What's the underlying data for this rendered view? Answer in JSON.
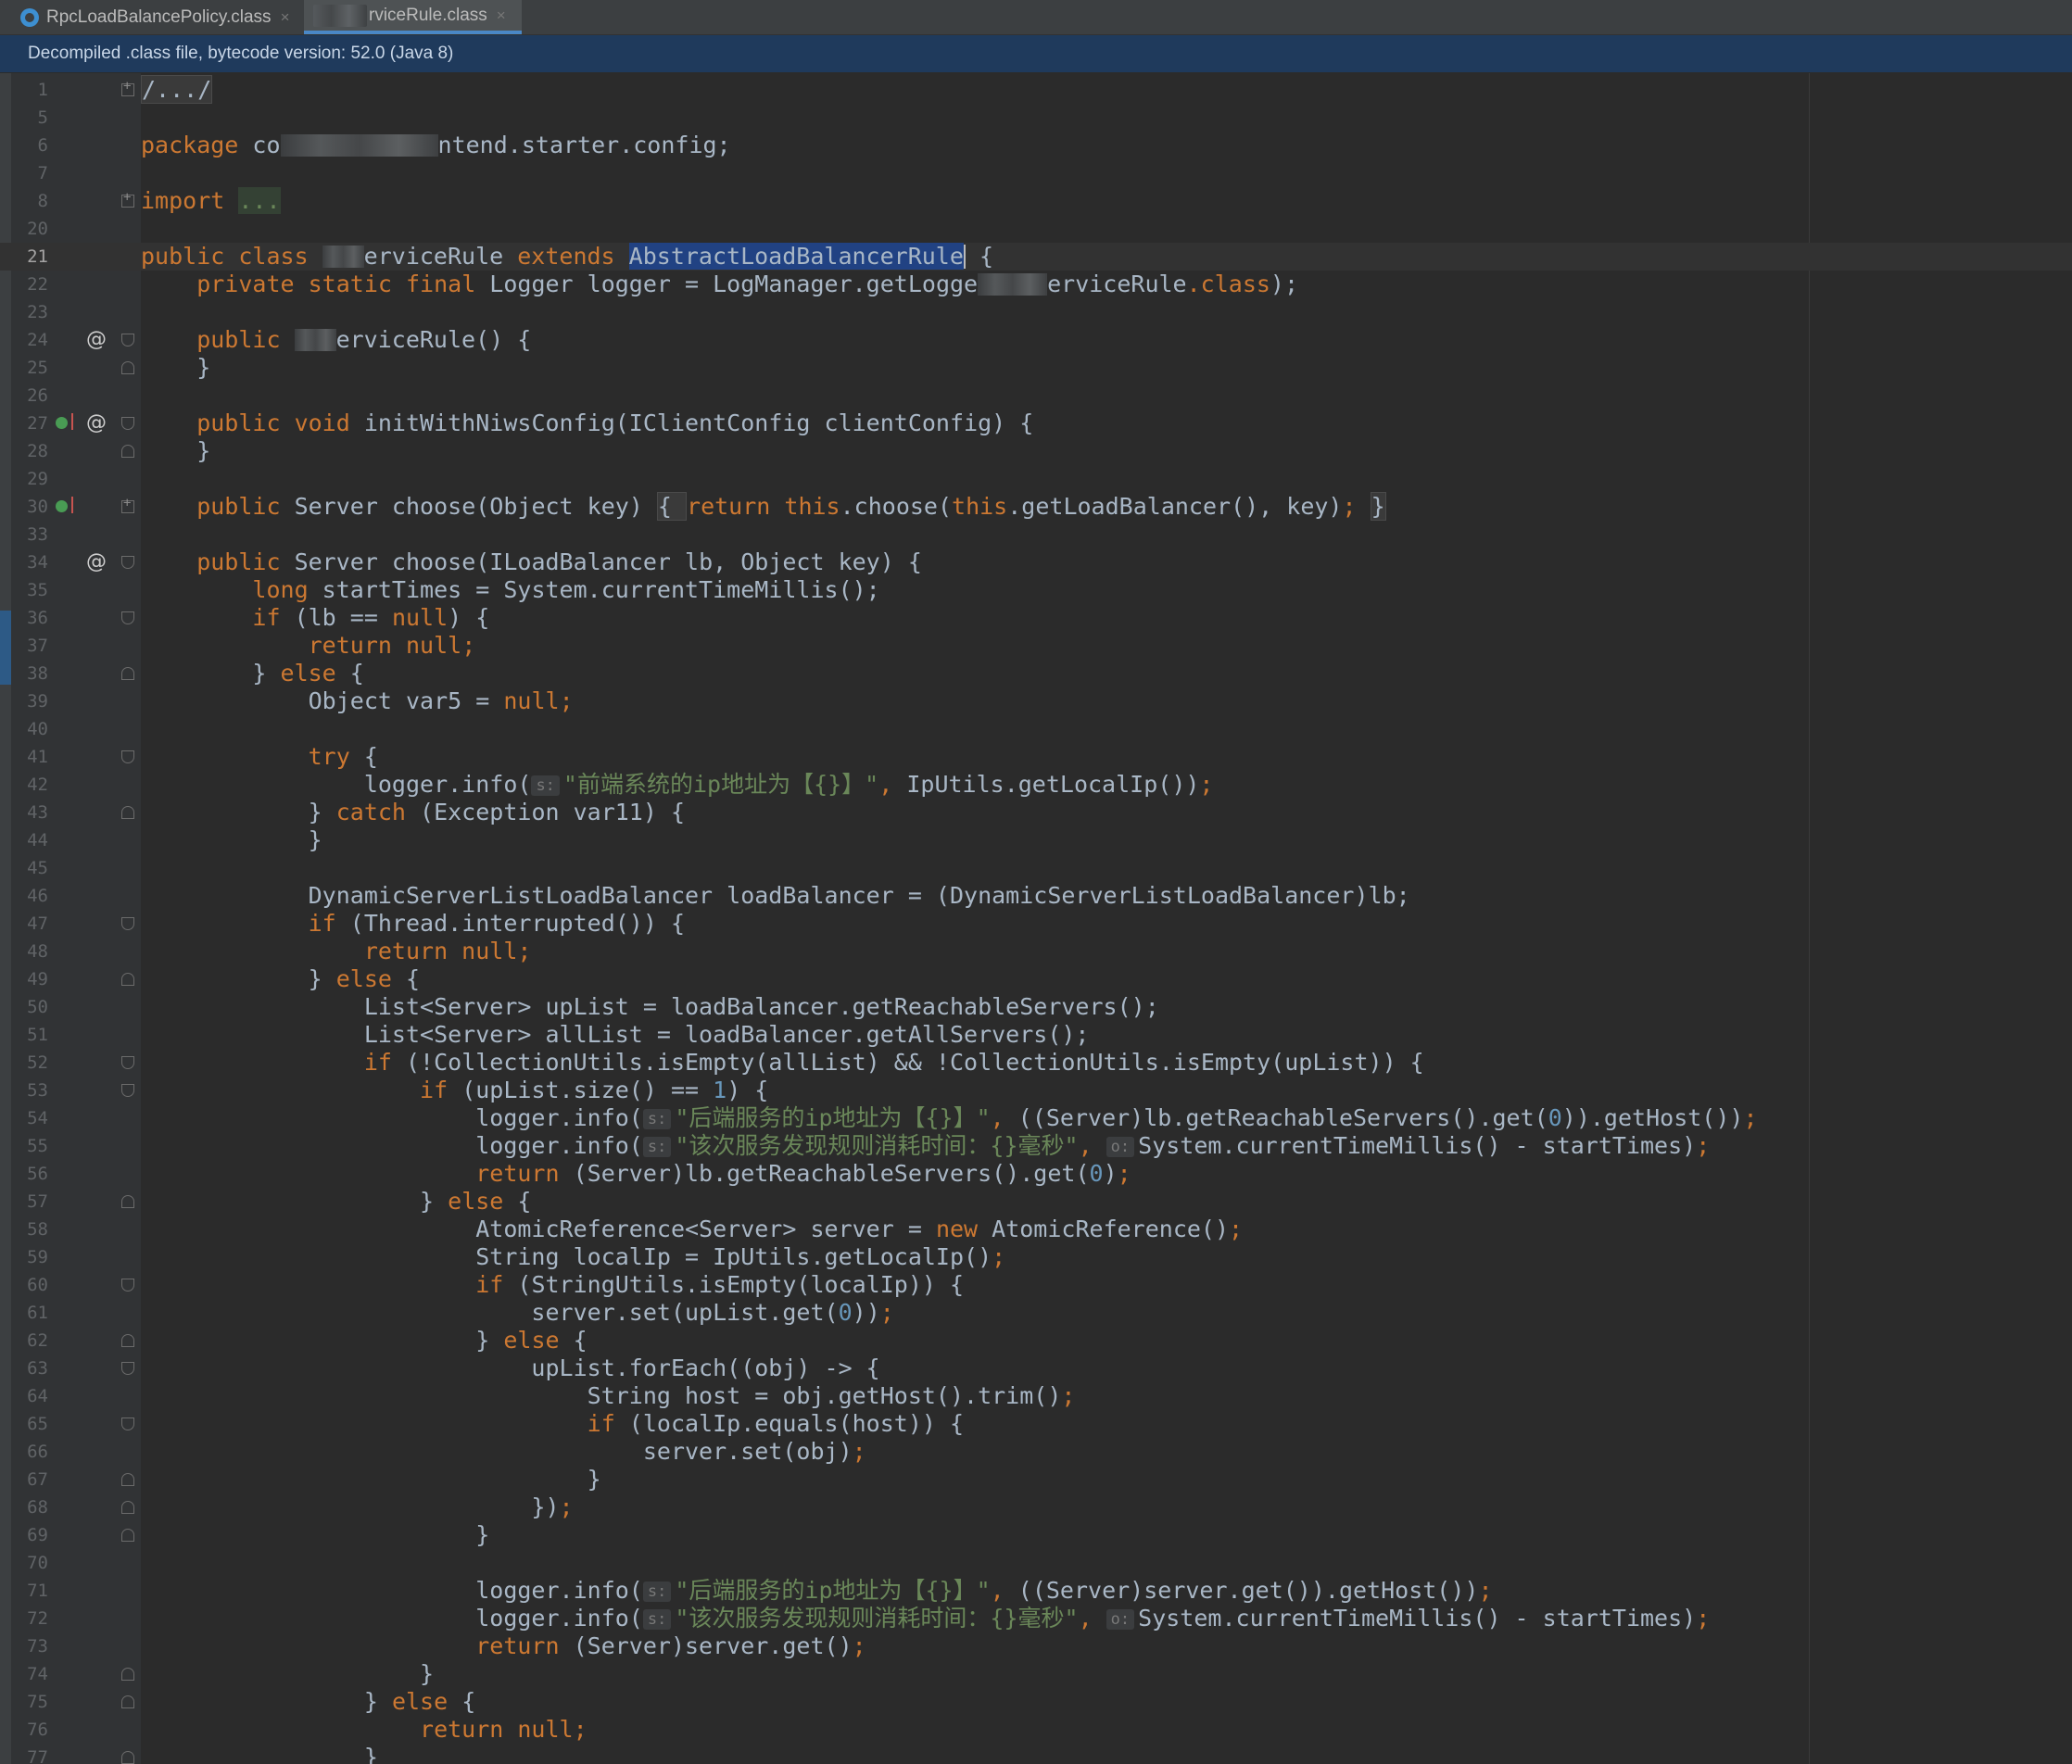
{
  "tabs": [
    {
      "label": "RpcLoadBalancePolicy.class",
      "close": "×",
      "icon": "class-file-icon"
    },
    {
      "label": "rviceRule.class",
      "close": "×",
      "icon": "class-file-icon"
    }
  ],
  "notice": "Decompiled .class file, bytecode version: 52.0 (Java 8)",
  "hints": {
    "s": "s:",
    "o": "o:"
  },
  "code": {
    "l1": "/.../",
    "l6a": "package ",
    "l6b": "co",
    "l6c": "ntend.starter.config;",
    "l8a": "import",
    "l8b": "...",
    "l21a": "public class ",
    "l21b": "erviceRule ",
    "l21c": "extends ",
    "l21d": "AbstractLoadBalancerRule",
    "l21e": " {",
    "l22a": "    private ",
    "l22b": "static final ",
    "l22c": "Logger logger = LogManager.getLogge",
    "l22d": "erviceRule",
    "l22e": ".class",
    "l22f": ");",
    "l24a": "    public ",
    "l24b": "erviceRule() {",
    "l25": "    }",
    "l27a": "    public void ",
    "l27b": "initWithNiwsConfig(IClientConfig clientConfig) {",
    "l28": "    }",
    "l30a": "    public ",
    "l30b": "Server choose(Object key) ",
    "l30c": "{ ",
    "l30d": "return this",
    "l30e": ".choose(",
    "l30f": "this",
    "l30g": ".getLoadBalancer(), key)",
    "l30h": "; ",
    "l30i": "}",
    "l34a": "    public ",
    "l34b": "Server choose(ILoadBalancer lb, Object key) {",
    "l35a": "        long ",
    "l35b": "startTimes = System.currentTimeMillis();",
    "l36a": "        if ",
    "l36b": "(lb == ",
    "l36c": "null",
    "l36d": ") {",
    "l37a": "            return null",
    "l37b": ";",
    "l38a": "        } ",
    "l38b": "else ",
    "l38c": "{",
    "l39a": "            Object var5 = ",
    "l39b": "null",
    "l39c": ";",
    "l41a": "            try ",
    "l41b": "{",
    "l42a": "                logger.info(",
    "l42b": "\"前端系统的ip地址为【{}】\"",
    "l42c": ", ",
    "l42d": "IpUtils.getLocalIp())",
    "l42e": ";",
    "l43a": "            } ",
    "l43b": "catch ",
    "l43c": "(Exception var11) {",
    "l44": "            }",
    "l46": "            DynamicServerListLoadBalancer loadBalancer = (DynamicServerListLoadBalancer)lb;",
    "l47a": "            if ",
    "l47b": "(Thread.interrupted()) {",
    "l48a": "                return null",
    "l48b": ";",
    "l49a": "            } ",
    "l49b": "else ",
    "l49c": "{",
    "l50": "                List<Server> upList = loadBalancer.getReachableServers();",
    "l51": "                List<Server> allList = loadBalancer.getAllServers();",
    "l52a": "                if ",
    "l52b": "(!CollectionUtils.isEmpty(allList) && !CollectionUtils.isEmpty(upList)) {",
    "l53a": "                    if ",
    "l53b": "(upList.size() == ",
    "l53c": "1",
    "l53d": ") {",
    "l54a": "                        logger.info(",
    "l54b": "\"后端服务的ip地址为【{}】\"",
    "l54c": ", ",
    "l54d": "((Server)lb.getReachableServers().get(",
    "l54e": "0",
    "l54f": ")).getHost())",
    "l54g": ";",
    "l55a": "                        logger.info(",
    "l55b": "\"该次服务发现规则消耗时间：{}毫秒\"",
    "l55c": ", ",
    "l55d": "System.currentTimeMillis() - startTimes)",
    "l55e": ";",
    "l56a": "                        return ",
    "l56b": "(Server)lb.getReachableServers().get(",
    "l56c": "0",
    "l56d": ")",
    "l56e": ";",
    "l57a": "                    } ",
    "l57b": "else ",
    "l57c": "{",
    "l58a": "                        AtomicReference<Server> server = ",
    "l58b": "new ",
    "l58c": "AtomicReference()",
    "l58d": ";",
    "l59a": "                        String localIp = IpUtils.getLocalIp()",
    "l59b": ";",
    "l60a": "                        if ",
    "l60b": "(StringUtils.isEmpty(localIp)) {",
    "l61a": "                            server.set(upList.get(",
    "l61b": "0",
    "l61c": "))",
    "l61d": ";",
    "l62a": "                        } ",
    "l62b": "else ",
    "l62c": "{",
    "l63": "                            upList.forEach((obj) -> {",
    "l64a": "                                String host = obj.getHost().trim()",
    "l64b": ";",
    "l65a": "                                if ",
    "l65b": "(localIp.equals(host)) {",
    "l66a": "                                    server.set(obj)",
    "l66b": ";",
    "l67": "                                }",
    "l68a": "                            })",
    "l68b": ";",
    "l69": "                        }",
    "l71a": "                        logger.info(",
    "l71b": "\"后端服务的ip地址为【{}】\"",
    "l71c": ", ",
    "l71d": "((Server)server.get()).getHost())",
    "l71e": ";",
    "l72a": "                        logger.info(",
    "l72b": "\"该次服务发现规则消耗时间：{}毫秒\"",
    "l72c": ", ",
    "l72d": "System.currentTimeMillis() - startTimes)",
    "l72e": ";",
    "l73a": "                        return ",
    "l73b": "(Server)server.get()",
    "l73c": ";",
    "l74": "                    }",
    "l75a": "                } ",
    "l75b": "else ",
    "l75c": "{",
    "l76a": "                    return null",
    "l76b": ";",
    "l77": "                }"
  },
  "line_numbers": [
    "1",
    "5",
    "6",
    "7",
    "8",
    "20",
    "21",
    "22",
    "23",
    "24",
    "25",
    "26",
    "27",
    "28",
    "29",
    "30",
    "33",
    "34",
    "35",
    "36",
    "37",
    "38",
    "39",
    "40",
    "41",
    "42",
    "43",
    "44",
    "45",
    "46",
    "47",
    "48",
    "49",
    "50",
    "51",
    "52",
    "53",
    "54",
    "55",
    "56",
    "57",
    "58",
    "59",
    "60",
    "61",
    "62",
    "63",
    "64",
    "65",
    "66",
    "67",
    "68",
    "69",
    "70",
    "71",
    "72",
    "73",
    "74",
    "75",
    "76",
    "77"
  ],
  "colors": {
    "background": "#2b2b2b",
    "keyword": "#cc7832",
    "string": "#6a8759",
    "number": "#6897bb",
    "text": "#a9b7c6",
    "selection": "#214283",
    "notice_bg": "#1f3a5c"
  }
}
